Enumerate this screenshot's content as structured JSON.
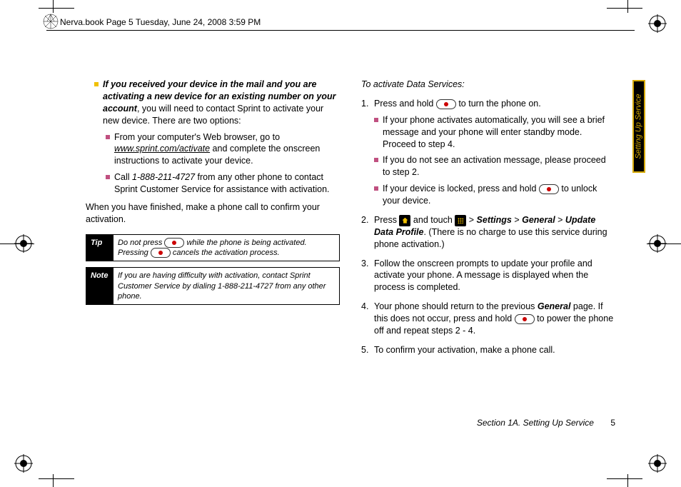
{
  "header": {
    "text": "Nerva.book  Page 5  Tuesday, June 24, 2008  3:59 PM"
  },
  "sideTab": "Setting Up Service",
  "col1": {
    "mailBullet": {
      "lead": "If you received your device in the mail and you are activating a new device for an existing number on your account",
      "tail": ", you will need to contact Sprint to activate your new device. There are two options:"
    },
    "sub1": {
      "lead": "From your computer's Web browser, go to ",
      "url": "www.sprint.com/activate",
      "tail": " and complete the onscreen instructions to activate your device."
    },
    "sub2": {
      "lead": "Call ",
      "phone": "1-888-211-4727",
      "tail": " from any other phone to contact Sprint Customer Service for assistance with activation."
    },
    "finishPara": "When you have finished, make a phone call to confirm your activation.",
    "tip": {
      "label": "Tip",
      "text1": "Do not press ",
      "text2": " while the phone is being activated. Pressing ",
      "text3": " cancels the activation process."
    },
    "note": {
      "label": "Note",
      "text": "If you are having difficulty with activation, contact Sprint Customer Service by dialing 1-888-211-4727 from any other phone."
    }
  },
  "col2": {
    "header": "To activate Data Services:",
    "step1": {
      "a": "Press and hold ",
      "b": " to turn the phone on."
    },
    "step1sub1": "If your phone activates automatically, you will see a brief message and your phone will enter standby mode. Proceed to step 4.",
    "step1sub2": "If you do not see an activation message, please proceed to step 2.",
    "step1sub3": {
      "a": "If your device is locked, press and hold ",
      "b": " to unlock your device."
    },
    "step2": {
      "a": "Press ",
      "b": " and touch ",
      "c": " > ",
      "path1": "Settings",
      "path2": "General",
      "path3": "Update Data Profile",
      "tail": ". (There is no charge to use this service during phone activation.)"
    },
    "step3": "Follow the onscreen prompts to update your profile and activate your phone. A message is displayed when the process is completed.",
    "step4": {
      "a": "Your phone should return to the previous ",
      "general": "General",
      "b": " page. If this does not occur, press and hold ",
      "c": " to power the phone off and repeat steps 2 - 4."
    },
    "step5": "To confirm your activation, make a phone call."
  },
  "footer": {
    "section": "Section 1A. Setting Up Service",
    "page": "5"
  }
}
